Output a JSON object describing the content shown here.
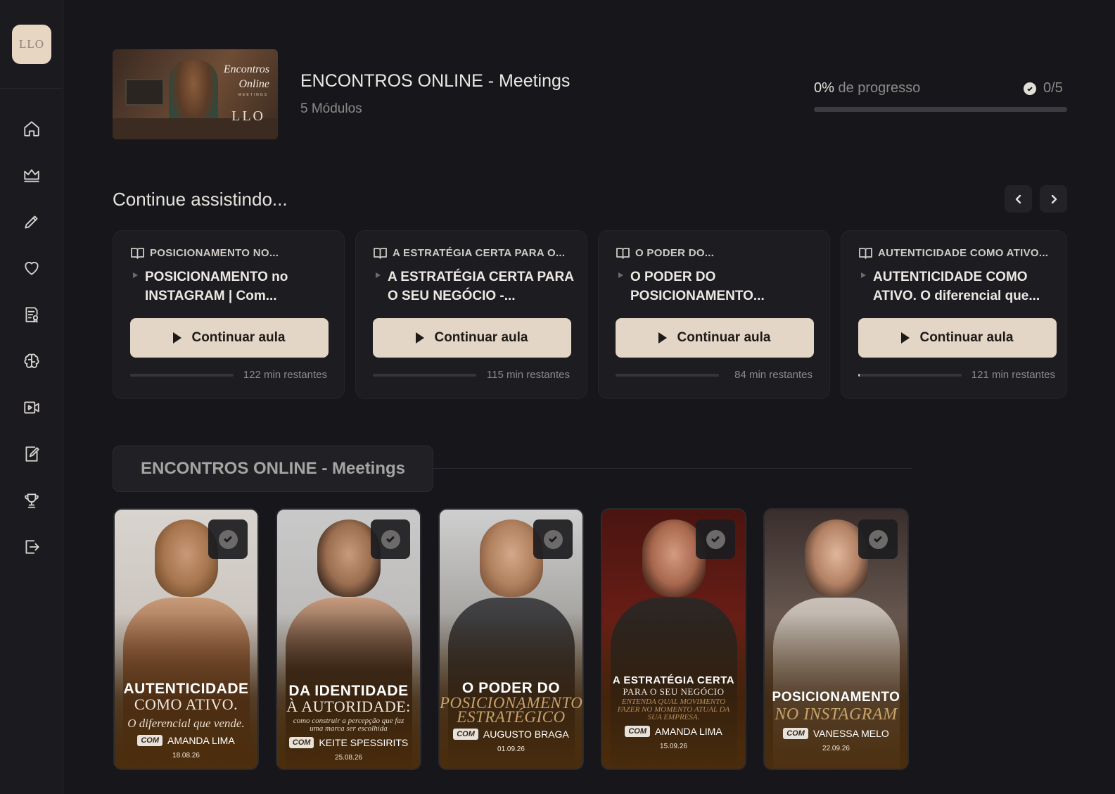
{
  "sidebar": {
    "logo_text": "LLO",
    "items": [
      {
        "name": "home"
      },
      {
        "name": "crown"
      },
      {
        "name": "pencil"
      },
      {
        "name": "heart"
      },
      {
        "name": "certificate"
      },
      {
        "name": "brain"
      },
      {
        "name": "video"
      },
      {
        "name": "edit-document"
      },
      {
        "name": "trophy"
      },
      {
        "name": "logout"
      }
    ]
  },
  "course": {
    "thumb_title_line1": "Encontros",
    "thumb_title_line2": "Online",
    "thumb_sub": "MEETINGS",
    "thumb_logo": "LLO",
    "title": "ENCONTROS ONLINE - Meetings",
    "modules": "5 Módulos"
  },
  "progress": {
    "percent_label": "0%",
    "suffix": " de progresso",
    "count": "0/5",
    "fraction": 0
  },
  "continue": {
    "title": "Continue assistindo...",
    "button_label": "Continuar aula",
    "cards": [
      {
        "module": "POSICIONAMENTO NO...",
        "lesson": "POSICIONAMENTO no INSTAGRAM | Com...",
        "remaining": "122 min restantes",
        "fraction": 0
      },
      {
        "module": "A ESTRATÉGIA CERTA PARA O...",
        "lesson": "A ESTRATÉGIA CERTA PARA O SEU NEGÓCIO -...",
        "remaining": "115 min restantes",
        "fraction": 0
      },
      {
        "module": "O PODER DO...",
        "lesson": "O PODER DO POSICIONAMENTO...",
        "remaining": "84 min restantes",
        "fraction": 0
      },
      {
        "module": "AUTENTICIDADE COMO ATIVO...",
        "lesson": "AUTENTICIDADE COMO ATIVO. O diferencial que...",
        "remaining": "121 min restantes",
        "fraction": 0.01
      }
    ]
  },
  "module_tab": {
    "label": "ENCONTROS ONLINE - Meetings"
  },
  "posters": [
    {
      "main": "AUTENTICIDADE",
      "serif": "COMO ATIVO.",
      "italic": "O diferencial que vende.",
      "com": "COM",
      "speaker": "AMANDA LIMA",
      "date": "18.08.26"
    },
    {
      "main": "DA IDENTIDADE",
      "serif": "À AUTORIDADE:",
      "italic": "como construir a percepção que faz uma marca ser escolhida",
      "com": "COM",
      "speaker": "KEITE SPESSIRITS",
      "date": "25.08.26"
    },
    {
      "main": "O PODER DO",
      "gold1": "POSICIONAMENTO",
      "gold2": "ESTRATÉGICO",
      "com": "COM",
      "speaker": "AUGUSTO BRAGA",
      "date": "01.09.26"
    },
    {
      "main": "A ESTRATÉGIA CERTA",
      "serif": "PARA O SEU NEGÓCIO",
      "italic": "ENTENDA QUAL MOVIMENTO FAZER NO MOMENTO ATUAL DA SUA EMPRESA.",
      "com": "COM",
      "speaker": "AMANDA LIMA",
      "date": "15.09.26"
    },
    {
      "main": "POSICIONAMENTO",
      "gold1": "NO INSTAGRAM",
      "com": "COM",
      "speaker": "VANESSA MELO",
      "date": "22.09.26"
    }
  ]
}
